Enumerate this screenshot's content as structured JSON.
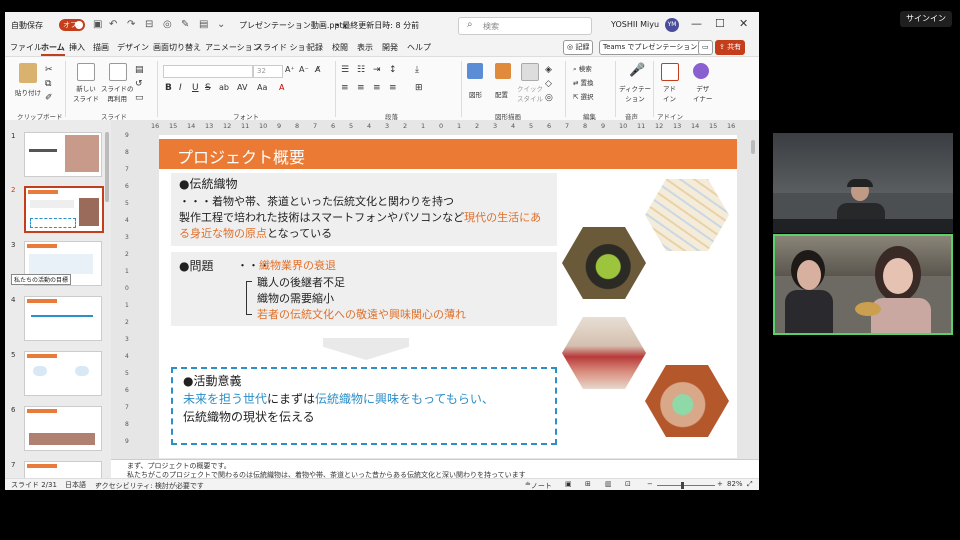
{
  "titlebar": {
    "autosave_label": "自動保存",
    "autosave_state": "オフ",
    "filename": "プレゼンテーション動画.pptx",
    "save_status": "• 最終更新日時: 8 分前",
    "search_placeholder": "検索",
    "user_name": "YOSHII Miyu",
    "user_initials": "YM",
    "minimize": "—",
    "maximize": "☐",
    "close": "✕"
  },
  "menu": {
    "tabs": [
      "ファイル",
      "ホーム",
      "挿入",
      "描画",
      "デザイン",
      "画面切り替え",
      "アニメーション",
      "スライド ショー",
      "記録",
      "校閲",
      "表示",
      "開発",
      "ヘルプ"
    ],
    "active_index": 1,
    "record_button": "◎ 記録",
    "teams_button": "Teams でプレゼンテーション",
    "share_button": "共有"
  },
  "ribbon": {
    "paste": "貼り付け",
    "new_slide": "新しい\nスライド",
    "reuse_slide": "スライドの\n再利用",
    "font_size": "32",
    "bold": "B",
    "italic": "I",
    "underline": "U",
    "strike": "S",
    "shapes": "図形",
    "arrange": "配置",
    "quick_styles": "クイック\nスタイル",
    "find": "検索",
    "replace": "置換",
    "select": "選択",
    "dictation": "ディクテー\nション",
    "addins": "アド\nイン",
    "designer": "デザ\nイナー",
    "groups": [
      "クリップボード",
      "スライド",
      "フォント",
      "段落",
      "図形描画",
      "編集",
      "音声",
      "アドイン"
    ]
  },
  "thumbnails": {
    "numbers": [
      "1",
      "2",
      "3",
      "4",
      "5",
      "6",
      "7"
    ],
    "selected": "2",
    "tooltip": "私たちの活動の目標"
  },
  "ruler": {
    "h": [
      "16",
      "15",
      "14",
      "13",
      "12",
      "11",
      "10",
      "9",
      "8",
      "7",
      "6",
      "5",
      "4",
      "3",
      "2",
      "1",
      "0",
      "1",
      "2",
      "3",
      "4",
      "5",
      "6",
      "7",
      "8",
      "9",
      "10",
      "11",
      "12",
      "13",
      "14",
      "15",
      "16"
    ],
    "v": [
      "9",
      "8",
      "7",
      "6",
      "5",
      "4",
      "3",
      "2",
      "1",
      "0",
      "1",
      "2",
      "3",
      "4",
      "5",
      "6",
      "7",
      "8",
      "9"
    ]
  },
  "slide": {
    "title": "プロジェクト概要",
    "sec1_heading": "●伝統織物",
    "sec1_line1": "・・・着物や帯、茶道といった伝統文化と関わりを持つ",
    "sec1_line2_a": "製作工程で培われた技術はスマートフォンやパソコンなど",
    "sec1_line2_b": "現代の生活にあ",
    "sec1_line3_a": "る身近な物の原点",
    "sec1_line3_b": "となっている",
    "sec2_heading": "●問題",
    "sec2_dots": "・・・",
    "sec2_main": "織物業界の衰退",
    "sec2_item1": "職人の後継者不足",
    "sec2_item2": "織物の需要縮小",
    "sec2_item3": "若者の伝統文化への敬遠や興味関心の薄れ",
    "sec3_heading": "●活動意義",
    "sec3_line1_a": "未来を担う世代",
    "sec3_line1_b": "にまずは",
    "sec3_line1_c": "伝統織物に興味をもってもらい、",
    "sec3_line2": "伝統織物の現状を伝える"
  },
  "notes": {
    "line1": "まず、プロジェクトの概要です。",
    "line2": "私たちがこのプロジェクトで関わるのは伝統織物は、着物や帯、茶道といった昔からある伝統文化と深い関わりを持っています"
  },
  "status": {
    "slide": "スライド 2/31",
    "language": "日本語",
    "accessibility": "アクセシビリティ: 検討が必要です",
    "notes": "ノート",
    "zoom": "82%"
  },
  "meeting": {
    "signin": "サインイン"
  },
  "colors": {
    "accent_orange": "#EA7A34",
    "ribbon_accent": "#C43E1C",
    "highlight_blue": "#2B8FC8",
    "speaker_border": "#5BD16A"
  }
}
